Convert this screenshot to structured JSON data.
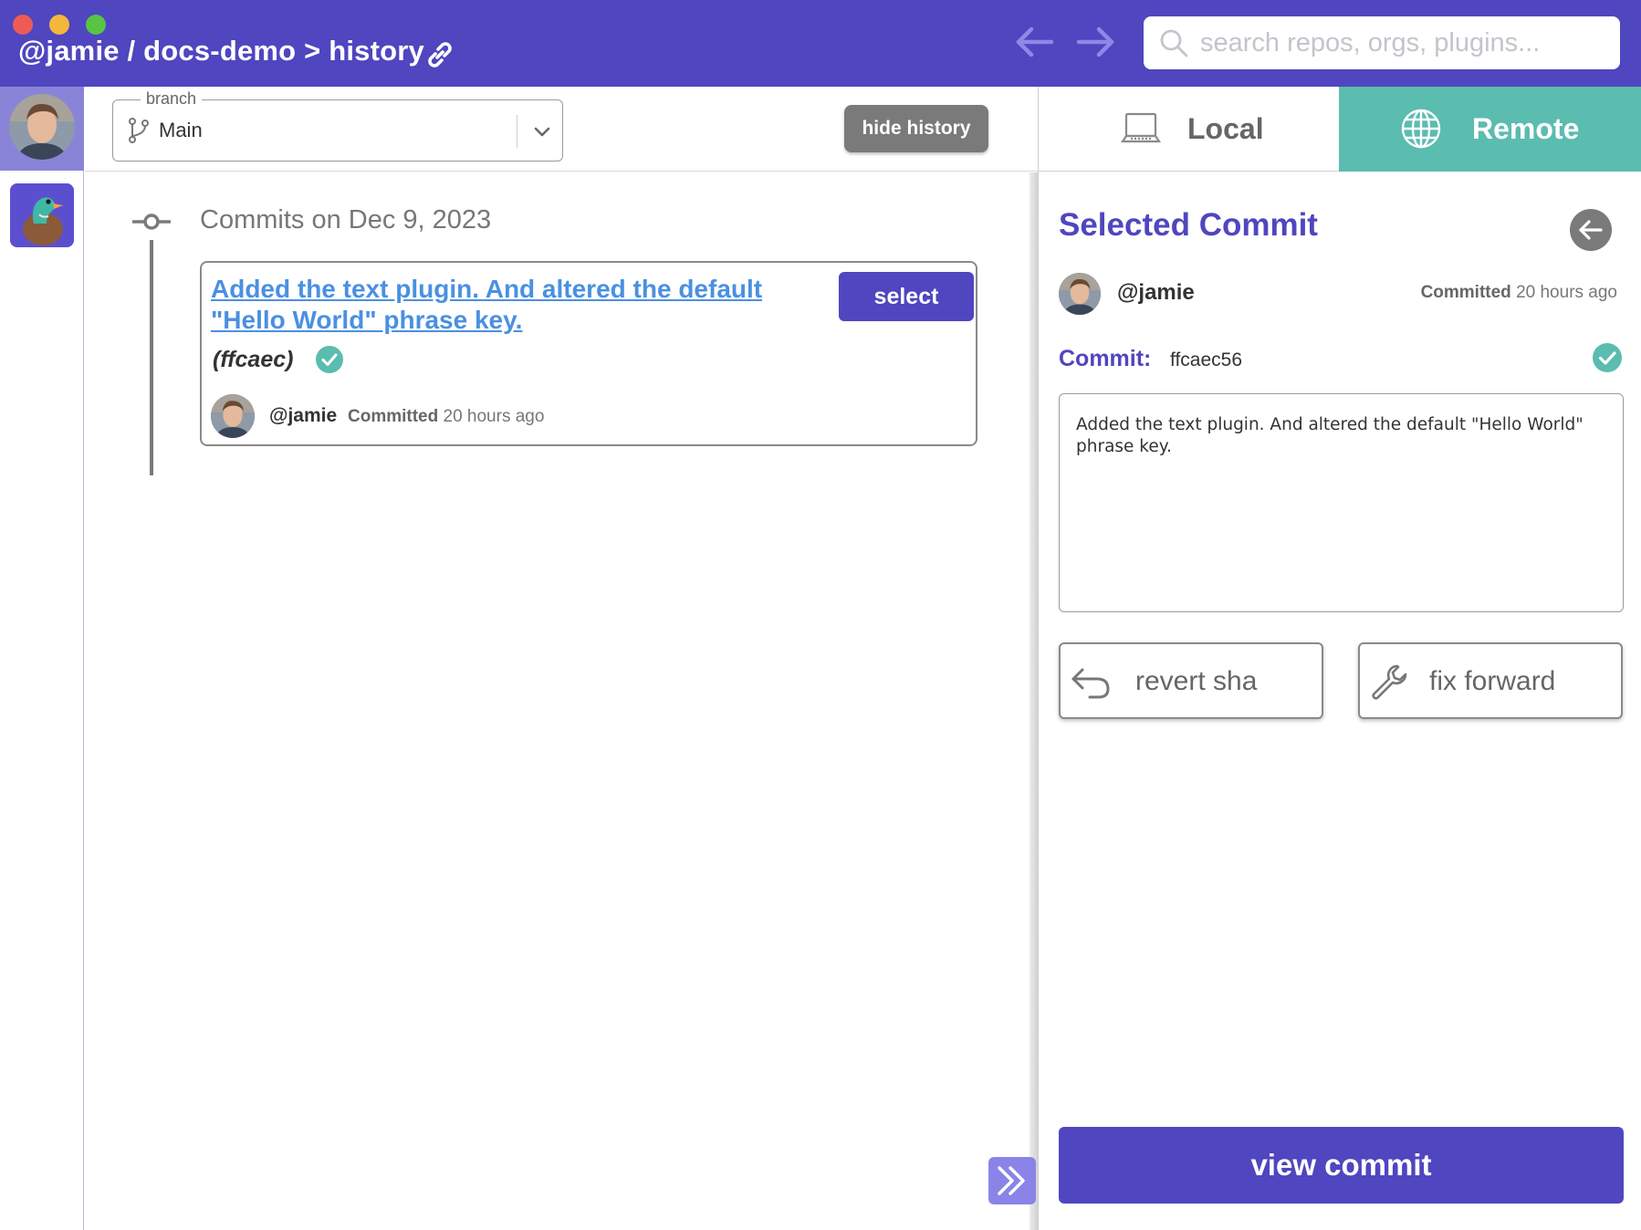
{
  "window": {
    "traffic_lights": [
      "close",
      "minimize",
      "zoom"
    ],
    "breadcrumb": "@jamie / docs-demo > history",
    "search": {
      "placeholder": "search repos, orgs, plugins..."
    }
  },
  "colors": {
    "brand": "#4f46c0",
    "remote_tab": "#5bbcb0",
    "link": "#4a90e2",
    "check": "#5bbcb0",
    "muted_button": "#7a7a7a"
  },
  "toolbar": {
    "branch_legend": "branch",
    "branch_value": "Main",
    "hide_history_label": "hide history"
  },
  "history": {
    "date_heading": "Commits on Dec 9, 2023",
    "commits": [
      {
        "message": "Added the text plugin. And altered the default \"Hello World\" phrase key.",
        "short_sha": "(ffcaec)",
        "select_label": "select",
        "user": "@jamie",
        "committed_label": "Committed",
        "time": "20 hours ago"
      }
    ]
  },
  "right_pane": {
    "tabs": [
      {
        "label": "Local",
        "icon": "laptop-icon",
        "active": false
      },
      {
        "label": "Remote",
        "icon": "globe-icon",
        "active": true
      }
    ],
    "selected_title": "Selected Commit",
    "user": "@jamie",
    "committed_label": "Committed",
    "time": "20 hours ago",
    "commit_label": "Commit:",
    "commit_sha": "ffcaec56",
    "message": "Added the text plugin. And altered the default \"Hello World\" phrase key.",
    "revert_label": "revert sha",
    "fix_forward_label": "fix forward",
    "view_commit_label": "view commit"
  }
}
